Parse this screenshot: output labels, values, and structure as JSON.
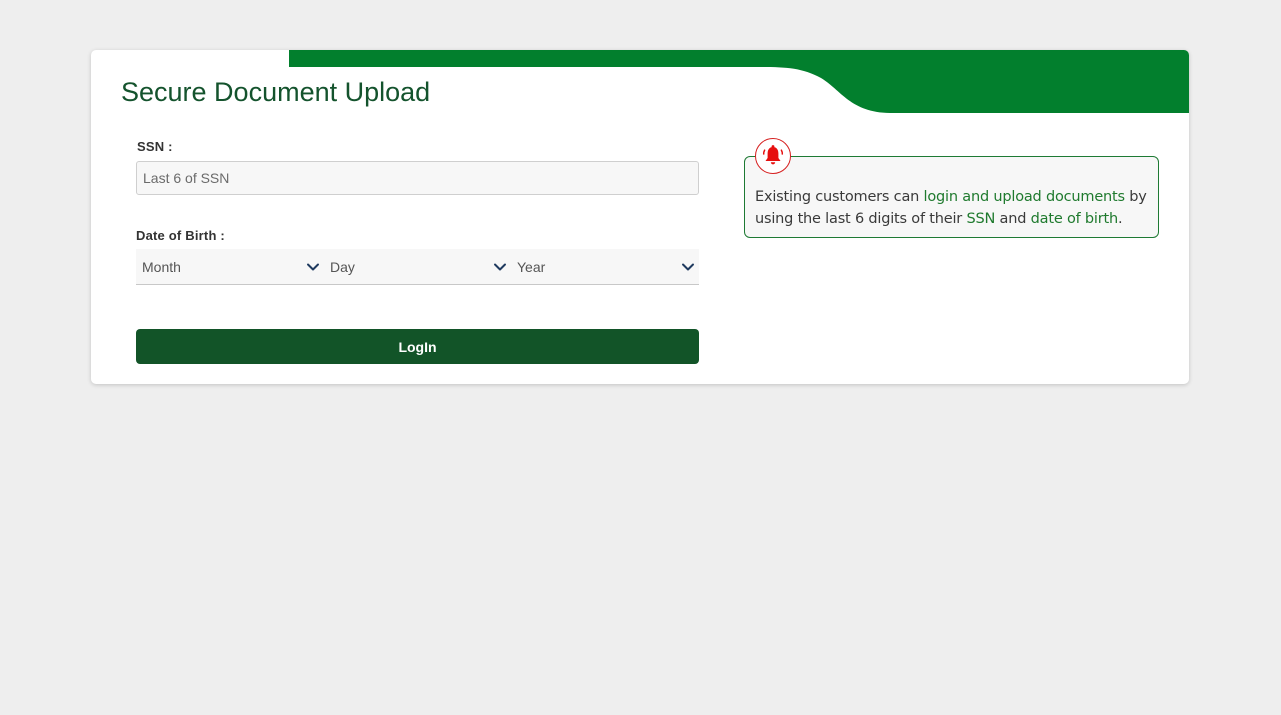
{
  "page": {
    "title": "Secure Document Upload"
  },
  "form": {
    "ssn_label": "SSN :",
    "ssn_placeholder": "Last 6 of SSN",
    "ssn_value": "",
    "dob_label": "Date of Birth :",
    "month_selected": "Month",
    "day_selected": "Day",
    "year_selected": "Year",
    "login_label": "LogIn"
  },
  "notice": {
    "icon": "bell-icon",
    "text_1": "Existing customers can ",
    "link_1": "login and upload documents",
    "text_2": " by using the last 6 digits of their ",
    "link_2": "SSN",
    "text_3": " and ",
    "link_3": "date of birth",
    "text_4": "."
  },
  "colors": {
    "brand_green": "#027f2d",
    "title_green": "#14532d",
    "button_green": "#125428",
    "alert_red": "#e60f0f",
    "background": "#eeeeee"
  }
}
